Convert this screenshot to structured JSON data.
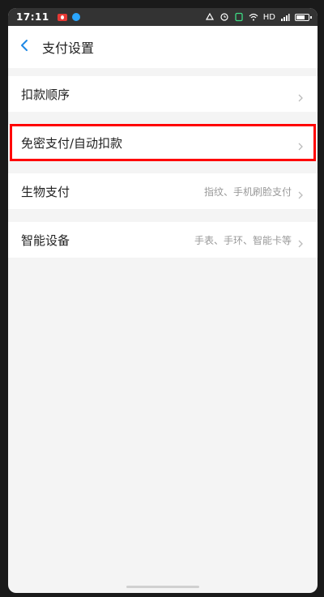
{
  "status_bar": {
    "time": "17:11",
    "network": "HD",
    "icons": [
      "record-icon",
      "dot-icon",
      "alarm-icon",
      "clock-icon",
      "shield-icon",
      "wifi-icon",
      "signal-icon",
      "battery-icon"
    ]
  },
  "header": {
    "title": "支付设置",
    "back_icon": "chevron-left-icon"
  },
  "rows": [
    {
      "label": "扣款顺序",
      "value": ""
    },
    {
      "label": "免密支付/自动扣款",
      "value": ""
    },
    {
      "label": "生物支付",
      "value": "指纹、手机刷脸支付"
    },
    {
      "label": "智能设备",
      "value": "手表、手环、智能卡等"
    }
  ],
  "colors": {
    "accent": "#1e88e5",
    "highlight": "#ff0000",
    "background": "#f4f4f4"
  }
}
